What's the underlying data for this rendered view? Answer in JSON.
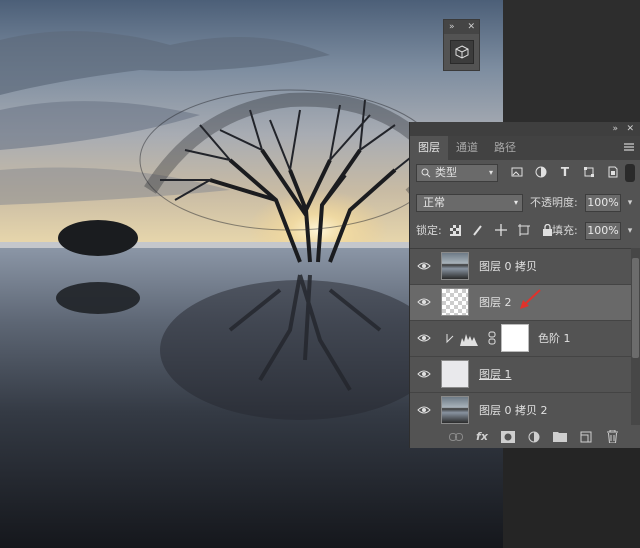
{
  "mini_panel": {
    "collapse_glyph": "»",
    "close_glyph": "✕",
    "tool_icon": "3d-object-icon"
  },
  "layers_panel": {
    "collapse_glyph": "»",
    "close_glyph": "✕",
    "tabs": [
      {
        "label": "图层",
        "active": true
      },
      {
        "label": "通道",
        "active": false
      },
      {
        "label": "路径",
        "active": false
      }
    ],
    "filter": {
      "kind_label": "类型",
      "icons": [
        "image-filter-icon",
        "adjustment-filter-icon",
        "type-filter-icon",
        "shape-filter-icon",
        "smart-object-filter-icon"
      ]
    },
    "blend_mode": "正常",
    "opacity_label": "不透明度:",
    "opacity_value": "100%",
    "lock_label": "锁定:",
    "fill_label": "填充:",
    "fill_value": "100%",
    "layers": [
      {
        "name": "图层 0 拷贝",
        "thumb": "photo",
        "visible": true,
        "selected": false
      },
      {
        "name": "图层 2",
        "thumb": "checker",
        "visible": true,
        "selected": true
      },
      {
        "name": "色阶 1",
        "thumb": "levels",
        "visible": true,
        "selected": false,
        "clipped": true
      },
      {
        "name": "图层 1",
        "thumb": "blank",
        "visible": true,
        "selected": false
      },
      {
        "name": "图层 0 拷贝 2",
        "thumb": "photo",
        "visible": true,
        "selected": false
      }
    ],
    "bottom_icons": [
      "link-layers-icon",
      "fx-icon",
      "add-mask-icon",
      "new-adjustment-icon",
      "new-group-icon",
      "new-layer-icon",
      "delete-layer-icon"
    ],
    "fx_label": "fx"
  },
  "colors": {
    "panel_bg": "#535353",
    "selected_row": "#696969",
    "annotation_arrow": "#e0322b"
  }
}
